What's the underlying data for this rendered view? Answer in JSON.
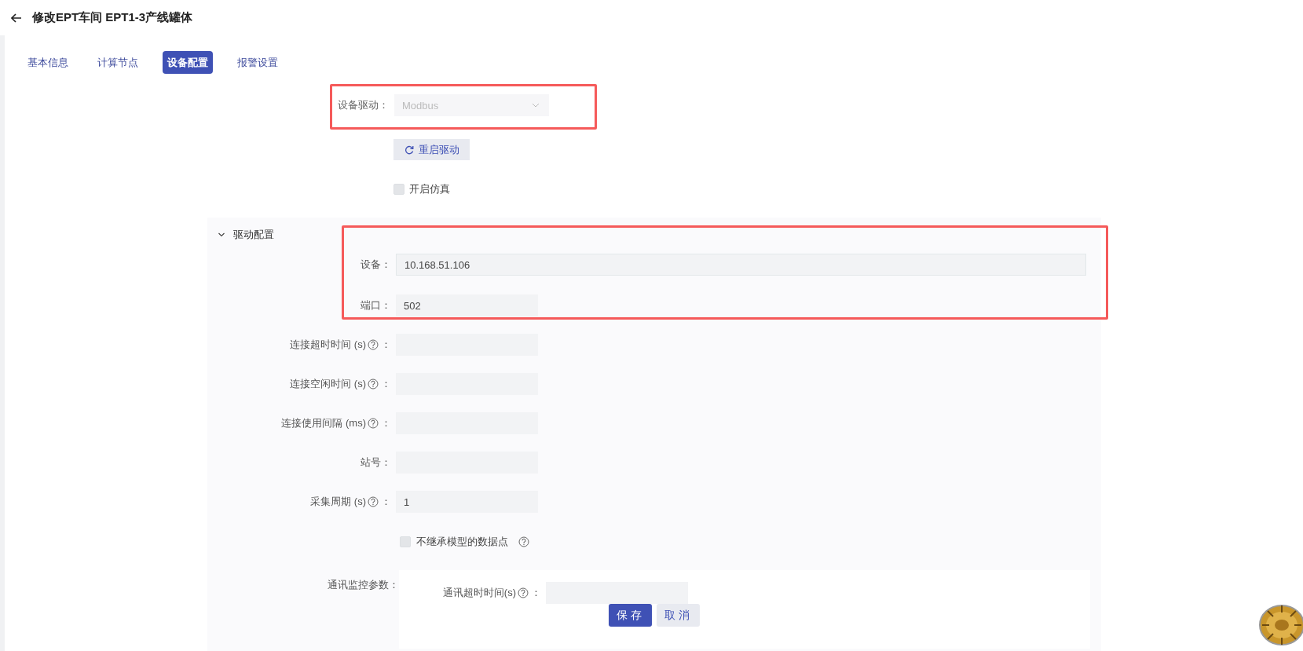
{
  "header": {
    "title": "修改EPT车间 EPT1-3产线罐体"
  },
  "tabs": [
    {
      "label": "基本信息",
      "selected": false
    },
    {
      "label": "计算节点",
      "selected": false
    },
    {
      "label": "设备配置",
      "selected": true
    },
    {
      "label": "报警设置",
      "selected": false
    }
  ],
  "driver": {
    "label": "设备驱动：",
    "value": "Modbus",
    "disabled": true,
    "highlighted": true
  },
  "restart_button": {
    "label": "重启驱动"
  },
  "simulation": {
    "label": "开启仿真",
    "checked": false
  },
  "driver_config": {
    "title": "驱动配置",
    "expanded": true,
    "highlight_group": {
      "highlighted": true,
      "fields": [
        {
          "label": "设备：",
          "value": "10.168.51.106",
          "kind": "wide"
        },
        {
          "label": "端口：",
          "value": "502",
          "kind": "short"
        }
      ]
    },
    "fields": [
      {
        "label": "连接超时时间 (s)",
        "help": true,
        "colon": "：",
        "kind": "short"
      },
      {
        "label": "连接空闲时间 (s)",
        "help": true,
        "colon": "：",
        "kind": "short"
      },
      {
        "label": "连接使用间隔 (ms)",
        "help": true,
        "colon": "：",
        "kind": "short"
      },
      {
        "label": "站号：",
        "help": false,
        "kind": "short"
      },
      {
        "label": "采集周期 (s)",
        "help": true,
        "colon": "：",
        "value": "1",
        "kind": "short"
      }
    ],
    "inherit_checkbox": {
      "label": "不继承模型的数据点",
      "checked": false,
      "help": true
    },
    "monitor": {
      "label": "通讯监控参数：",
      "fields": [
        {
          "label": "通讯超时时间(s)",
          "help": true,
          "colon": "："
        }
      ]
    }
  },
  "actions": [
    {
      "label": "保存",
      "kind": "primary"
    },
    {
      "label": "取消",
      "kind": "secondary"
    }
  ]
}
